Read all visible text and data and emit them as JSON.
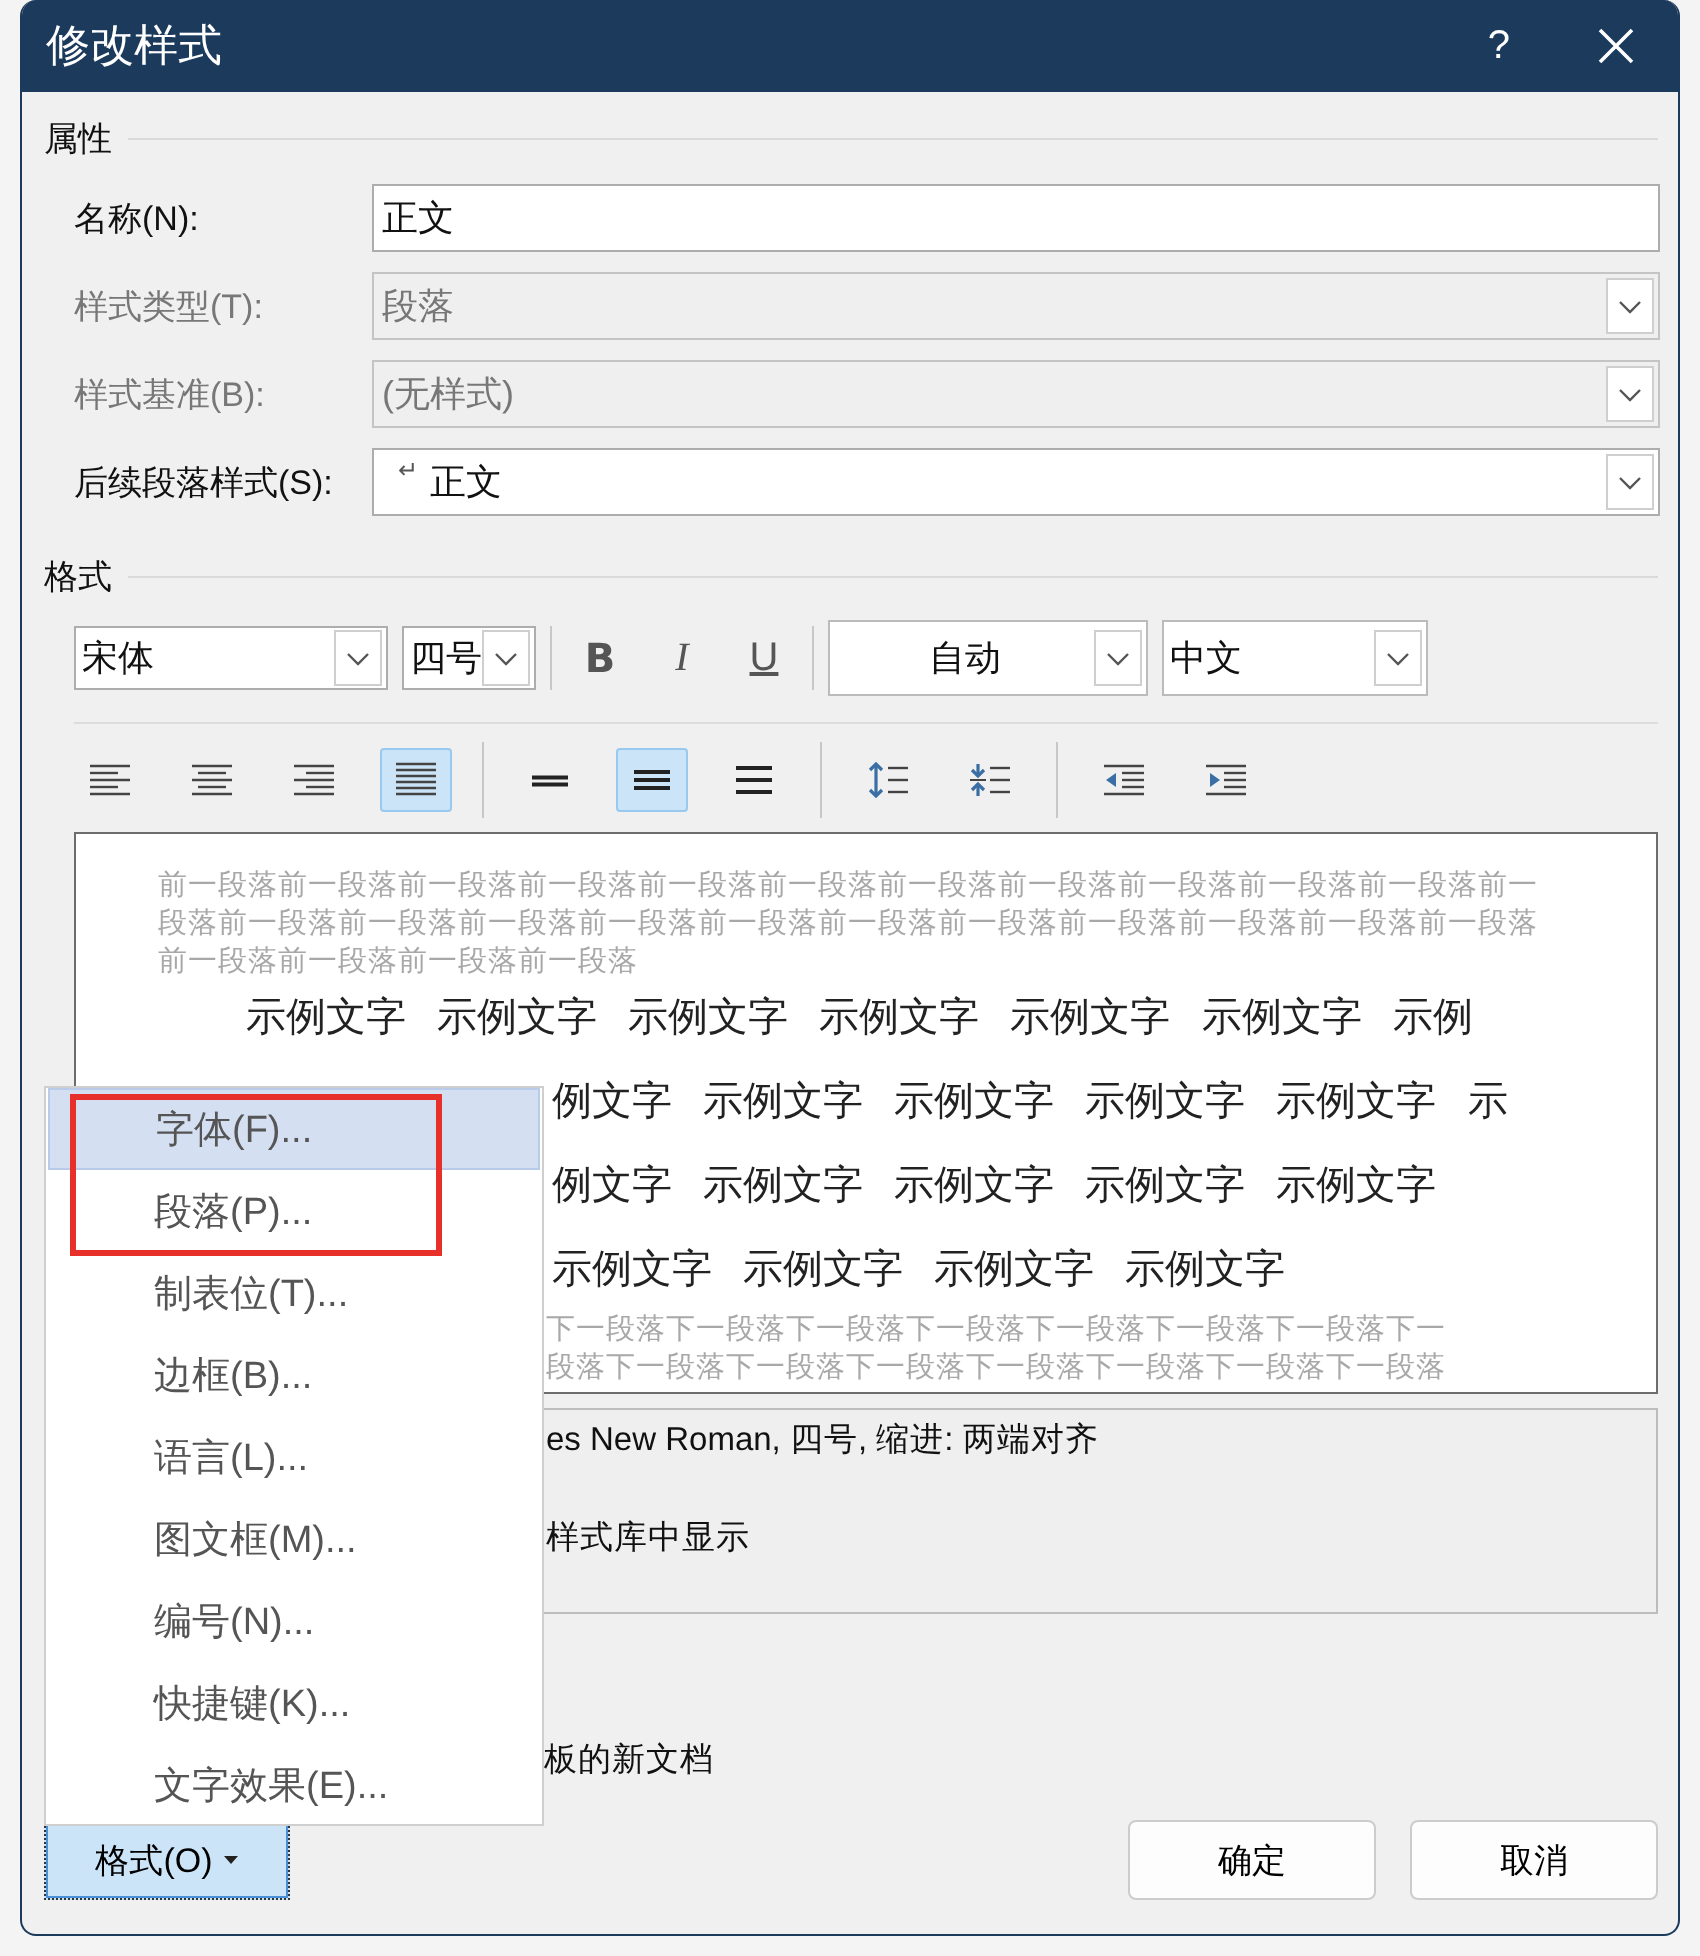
{
  "window": {
    "title": "修改样式",
    "help": "?"
  },
  "properties": {
    "heading": "属性",
    "fields": [
      {
        "label": "名称(N):",
        "value": "正文",
        "kind": "text",
        "disabled": false
      },
      {
        "label": "样式类型(T):",
        "value": "段落",
        "kind": "dropdown",
        "disabled": true
      },
      {
        "label": "样式基准(B):",
        "value": "(无样式)",
        "kind": "dropdown",
        "disabled": true
      },
      {
        "label": "后续段落样式(S):",
        "prefix": "↵",
        "value": "正文",
        "kind": "dropdown",
        "disabled": false
      }
    ]
  },
  "format": {
    "heading": "格式",
    "font": "宋体",
    "size": "四号",
    "style_buttons": [
      {
        "label": "B",
        "kind": "bold"
      },
      {
        "label": "I",
        "kind": "italic"
      },
      {
        "label": "U",
        "kind": "underline"
      }
    ],
    "font_color_setting": "自动",
    "language": "中文",
    "paragraph_buttons": [
      {
        "kind": "align-left",
        "selected": false
      },
      {
        "kind": "align-center",
        "selected": false
      },
      {
        "kind": "align-right",
        "selected": false
      },
      {
        "kind": "justify",
        "selected": true
      },
      {
        "kind": "spacing-single",
        "selected": false
      },
      {
        "kind": "spacing-one-half",
        "selected": true
      },
      {
        "kind": "spacing-double",
        "selected": false
      },
      {
        "kind": "space-before-increase",
        "selected": false
      },
      {
        "kind": "space-before-decrease",
        "selected": false
      },
      {
        "kind": "indent-decrease",
        "selected": false
      },
      {
        "kind": "indent-increase",
        "selected": false
      }
    ]
  },
  "preview": {
    "lines": [
      {
        "kind": "before",
        "text": "前一段落前一段落前一段落前一段落前一段落前一段落前一段落前一段落前一段落前一段落前一段落前一"
      },
      {
        "kind": "before",
        "text": "段落前一段落前一段落前一段落前一段落前一段落前一段落前一段落前一段落前一段落前一段落前一段落"
      },
      {
        "kind": "before",
        "text": "前一段落前一段落前一段落前一段落"
      },
      {
        "kind": "sample",
        "text": "示例文字 示例文字 示例文字 示例文字 示例文字 示例文字 示例"
      },
      {
        "kind": "sample-cut",
        "text": "例文字 示例文字 示例文字 示例文字 示例文字 示"
      },
      {
        "kind": "sample-cut",
        "text": "例文字 示例文字 示例文字 示例文字 示例文字"
      },
      {
        "kind": "sample-cut",
        "text": "示例文字 示例文字 示例文字 示例文字"
      },
      {
        "kind": "after-cut",
        "text": "下一段落下一段落下一段落下一段落下一段落下一段落下一段落下一"
      },
      {
        "kind": "after-cut",
        "text": "段落下一段落下一段落下一段落下一段落下一段落下一段落下一段落"
      }
    ]
  },
  "description": {
    "lines": [
      "es New Roman, 四号, 缩进: 两端对齐",
      "样式库中显示"
    ]
  },
  "template_option": "板的新文档",
  "format_button": "格式(O)",
  "buttons": [
    "确定",
    "取消"
  ],
  "menu": {
    "items": [
      {
        "label": "字体(F)...",
        "selected": true
      },
      {
        "label": "段落(P)...",
        "selected": false
      },
      {
        "label": "制表位(T)...",
        "selected": false
      },
      {
        "label": "边框(B)...",
        "selected": false
      },
      {
        "label": "语言(L)...",
        "selected": false
      },
      {
        "label": "图文框(M)...",
        "selected": false
      },
      {
        "label": "编号(N)...",
        "selected": false
      },
      {
        "label": "快捷键(K)...",
        "selected": false
      },
      {
        "label": "文字效果(E)...",
        "selected": false
      }
    ]
  }
}
